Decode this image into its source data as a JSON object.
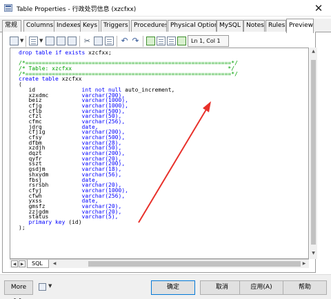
{
  "window": {
    "title": "Table Properties - 行政处罚信息 (xzcfxx)",
    "close_glyph": "✕"
  },
  "tabs": [
    {
      "label": "常规"
    },
    {
      "label": "Columns"
    },
    {
      "label": "Indexes"
    },
    {
      "label": "Keys"
    },
    {
      "label": "Triggers"
    },
    {
      "label": "Procedures"
    },
    {
      "label": "Physical Options"
    },
    {
      "label": "MySQL"
    },
    {
      "label": "Notes"
    },
    {
      "label": "Rules"
    },
    {
      "label": "Preview",
      "active": true
    }
  ],
  "toolbar": {
    "cursor_position": "Ln 1, Col 1",
    "icons": [
      "properties-icon",
      "new-icon",
      "open-icon",
      "save-icon",
      "print-icon",
      "cut-icon",
      "copy-icon",
      "paste-icon",
      "undo-icon",
      "redo-icon",
      "find-icon",
      "replace-icon",
      "insert-icon",
      "check-icon"
    ]
  },
  "editor": {
    "lines": [
      {
        "text": "drop table if exists xzcfxx;",
        "style": "kw"
      },
      {
        "text": "",
        "style": "plain"
      },
      {
        "text": "/*==============================================================*/",
        "style": "cm"
      },
      {
        "text": "/* Table: xzcfxx                                               */",
        "style": "cm"
      },
      {
        "text": "/*==============================================================*/",
        "style": "cm"
      },
      {
        "text": "create table xzcfxx",
        "style": "kw"
      },
      {
        "text": "(",
        "style": "plain"
      },
      {
        "name": "id",
        "type": "int not null auto_increment,",
        "style": "col"
      },
      {
        "name": "xzxdmc",
        "type": "varchar(200),",
        "style": "col"
      },
      {
        "name": "beiz",
        "type": "varchar(1000),",
        "style": "col"
      },
      {
        "name": "cfjg",
        "type": "varchar(1000),",
        "style": "col"
      },
      {
        "name": "cflb",
        "type": "varchar(500),",
        "style": "col"
      },
      {
        "name": "cfzl",
        "type": "varchar(50),",
        "style": "col"
      },
      {
        "name": "cfmc",
        "type": "varchar(256),",
        "style": "col"
      },
      {
        "name": "jdrq",
        "type": "date,",
        "style": "col"
      },
      {
        "name": "cfjig",
        "type": "varchar(200),",
        "style": "col"
      },
      {
        "name": "cfsy",
        "type": "varchar(500),",
        "style": "col"
      },
      {
        "name": "dfbm",
        "type": "varchar(28),",
        "style": "col"
      },
      {
        "name": "xzdjh",
        "type": "varchar(50),",
        "style": "col"
      },
      {
        "name": "dqzt",
        "type": "varchar(200),",
        "style": "col"
      },
      {
        "name": "qyfr",
        "type": "varchar(20),",
        "style": "col"
      },
      {
        "name": "sszt",
        "type": "varchar(200),",
        "style": "col"
      },
      {
        "name": "gsdjm",
        "type": "varchar(18),",
        "style": "col"
      },
      {
        "name": "shxydm",
        "type": "varchar(56),",
        "style": "col"
      },
      {
        "name": "fbsj",
        "type": "date,",
        "style": "col"
      },
      {
        "name": "rsrsbh",
        "type": "varchar(20),",
        "style": "col"
      },
      {
        "name": "cfyj",
        "type": "varchar(1000),",
        "style": "col"
      },
      {
        "name": "cfwh",
        "type": "varchar(256),",
        "style": "col"
      },
      {
        "name": "yxss",
        "type": "date,",
        "style": "col"
      },
      {
        "name": "gmsfz",
        "type": "varchar(20),",
        "style": "col"
      },
      {
        "name": "zzjgdm",
        "type": "varchar(20),",
        "style": "col"
      },
      {
        "name": "status",
        "type": "varchar(5),",
        "style": "col"
      },
      {
        "text": "   primary key (id)",
        "style": "pk"
      },
      {
        "text": ");",
        "style": "plain"
      }
    ],
    "sheet_tab": "SQL"
  },
  "footer": {
    "more_label": "More >>",
    "ok_label": "确定",
    "cancel_label": "取消",
    "apply_label": "应用(A)",
    "help_label": "帮助"
  },
  "colors": {
    "keyword": "#0000ff",
    "comment": "#00a000",
    "annotation_arrow": "#e8302a",
    "primary_button_border": "#0078d7"
  }
}
